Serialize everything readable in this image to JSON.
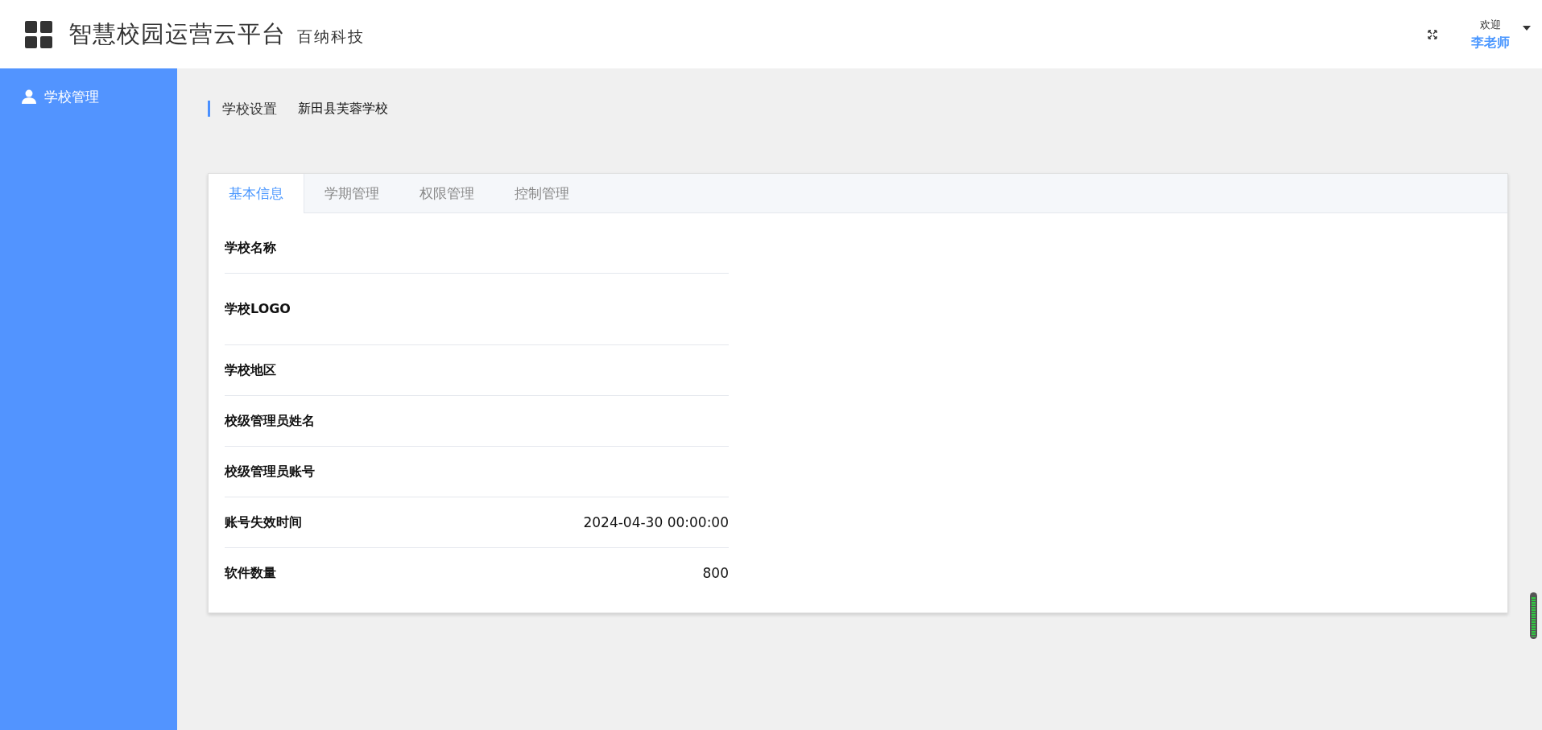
{
  "header": {
    "title": "智慧校园运营云平台",
    "subtitle": "百纳科技",
    "greeting": "欢迎",
    "user": "李老师"
  },
  "sidebar": {
    "items": [
      {
        "label": "学校管理",
        "selected": true
      }
    ]
  },
  "breadcrumb": {
    "section": "学校设置",
    "school": "新田县芙蓉学校"
  },
  "tabs": [
    {
      "label": "基本信息",
      "selected": true
    },
    {
      "label": "学期管理",
      "selected": false
    },
    {
      "label": "权限管理",
      "selected": false
    },
    {
      "label": "控制管理",
      "selected": false
    }
  ],
  "fields": [
    {
      "label": "学校名称",
      "kind": "text"
    },
    {
      "label": "学校LOGO",
      "kind": "image"
    },
    {
      "label": "学校地区",
      "kind": "text"
    },
    {
      "label": "校级管理员姓名",
      "kind": "text"
    },
    {
      "label": "校级管理员账号",
      "kind": "text"
    },
    {
      "label": "账号失效时间",
      "kind": "text",
      "value": "2024-04-30 00:00:00"
    },
    {
      "label": "软件数量",
      "kind": "text",
      "value": "800"
    }
  ]
}
